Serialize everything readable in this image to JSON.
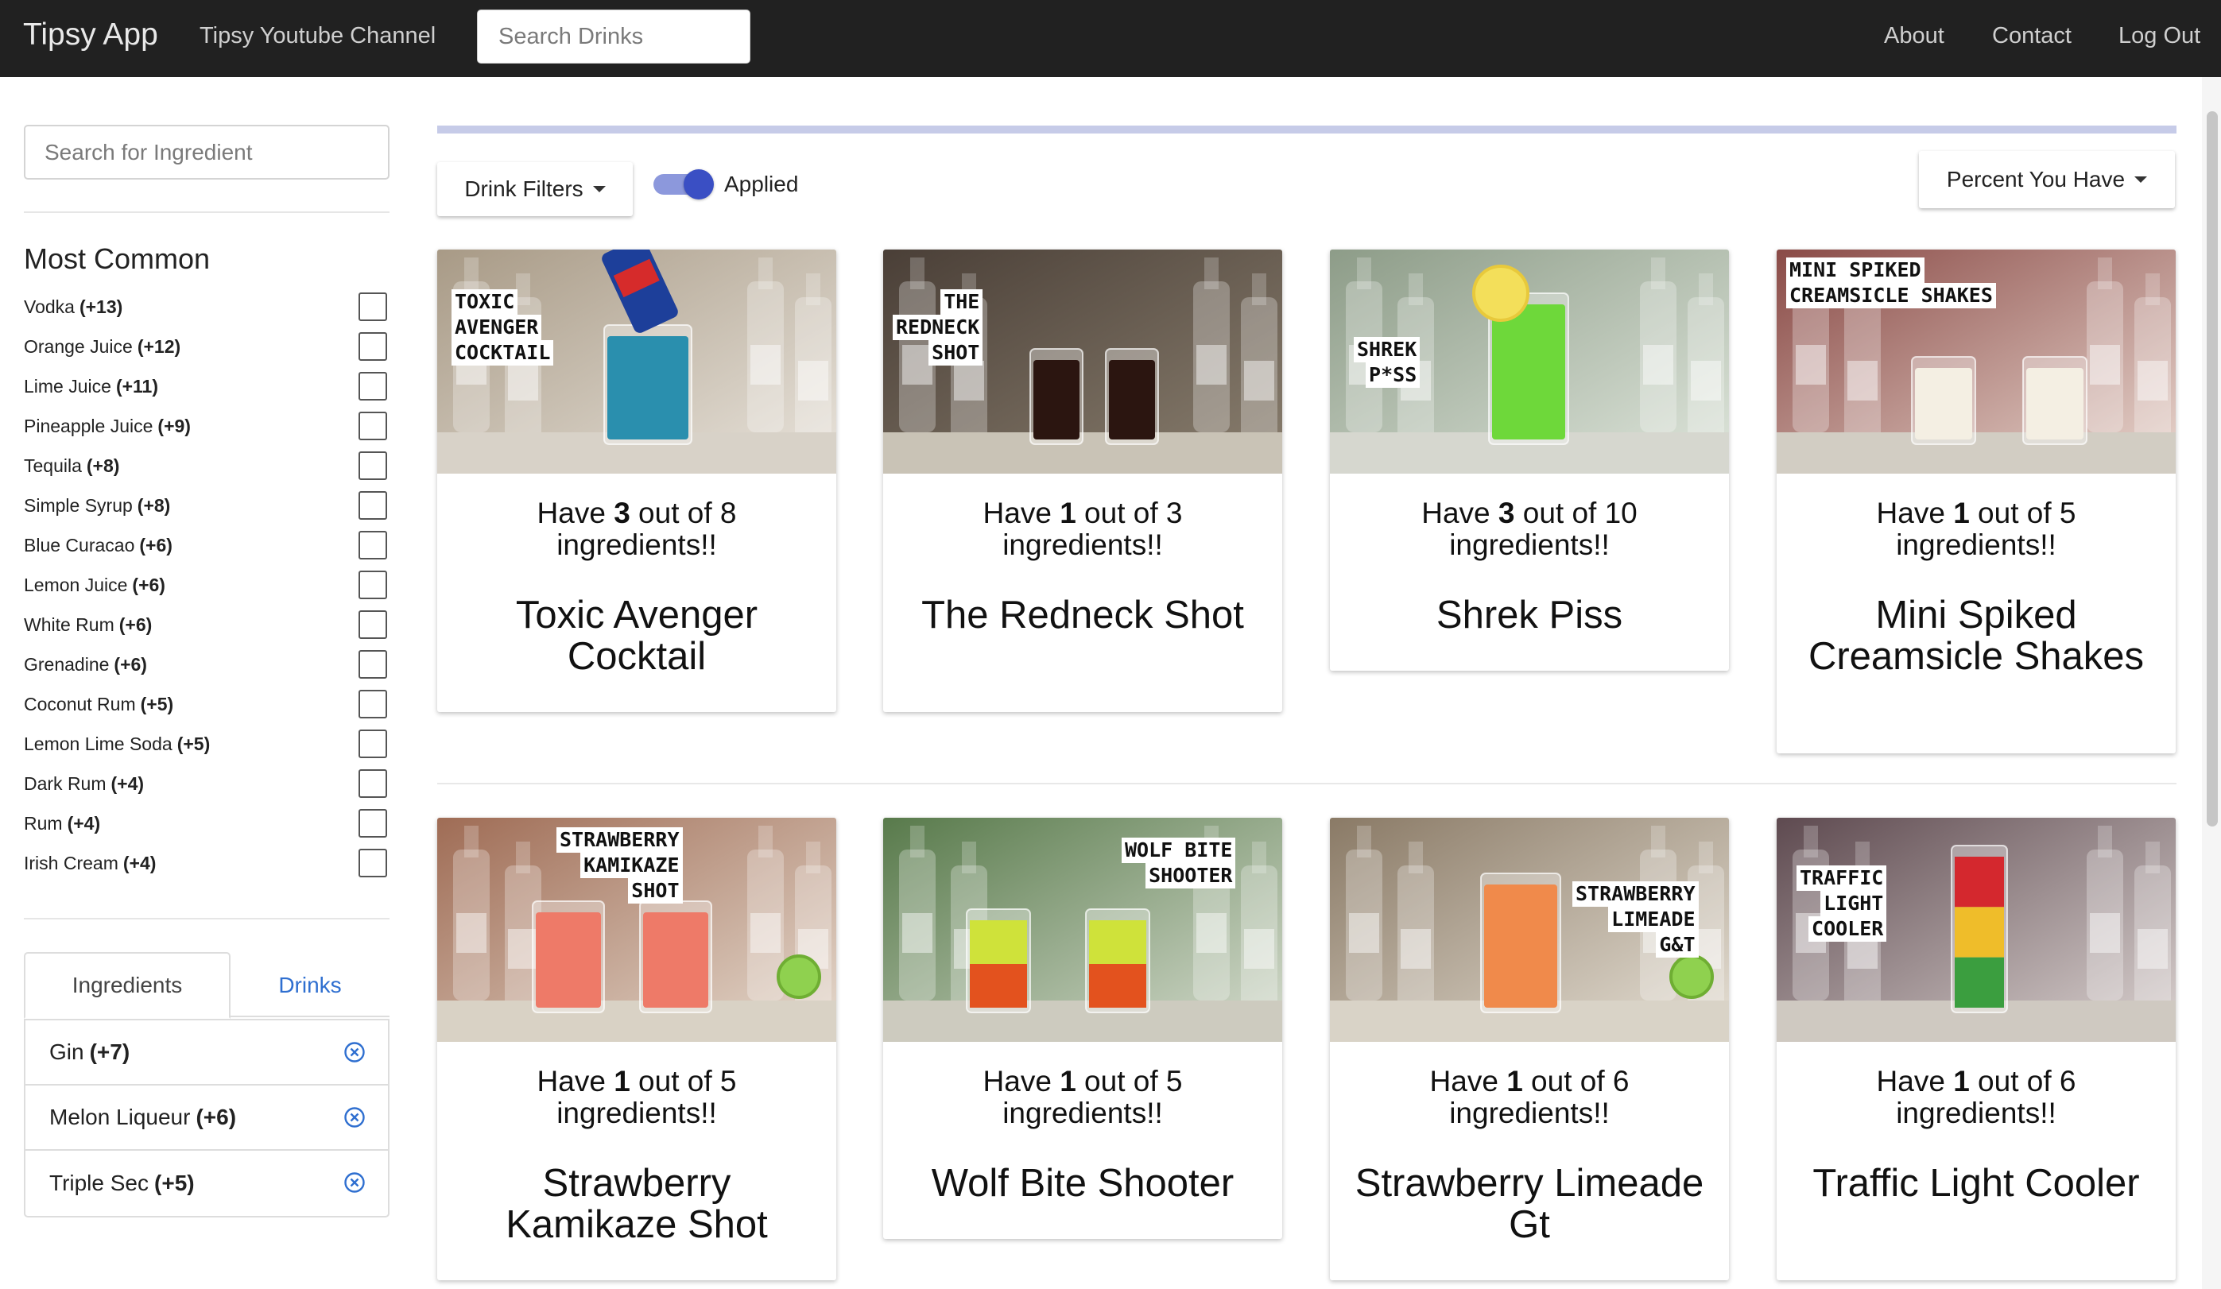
{
  "navbar": {
    "brand": "Tipsy App",
    "youtube_link": "Tipsy Youtube Channel",
    "search_placeholder": "Search Drinks",
    "about": "About",
    "contact": "Contact",
    "logout": "Log Out"
  },
  "sidebar": {
    "search_placeholder": "Search for Ingredient",
    "heading": "Most Common",
    "common": [
      {
        "name": "Vodka",
        "count": "(+13)"
      },
      {
        "name": "Orange Juice",
        "count": "(+12)"
      },
      {
        "name": "Lime Juice",
        "count": "(+11)"
      },
      {
        "name": "Pineapple Juice",
        "count": "(+9)"
      },
      {
        "name": "Tequila",
        "count": "(+8)"
      },
      {
        "name": "Simple Syrup",
        "count": "(+8)"
      },
      {
        "name": "Blue Curacao",
        "count": "(+6)"
      },
      {
        "name": "Lemon Juice",
        "count": "(+6)"
      },
      {
        "name": "White Rum",
        "count": "(+6)"
      },
      {
        "name": "Grenadine",
        "count": "(+6)"
      },
      {
        "name": "Coconut Rum",
        "count": "(+5)"
      },
      {
        "name": "Lemon Lime Soda",
        "count": "(+5)"
      },
      {
        "name": "Dark Rum",
        "count": "(+4)"
      },
      {
        "name": "Rum",
        "count": "(+4)"
      },
      {
        "name": "Irish Cream",
        "count": "(+4)"
      }
    ],
    "tabs": {
      "ingredients": "Ingredients",
      "drinks": "Drinks"
    },
    "selected": [
      {
        "name": "Gin",
        "count": "(+7)"
      },
      {
        "name": "Melon Liqueur",
        "count": "(+6)"
      },
      {
        "name": "Triple Sec",
        "count": "(+5)"
      }
    ]
  },
  "main": {
    "filters_label": "Drink Filters",
    "toggle_label": "Applied",
    "sort_label": "Percent You Have",
    "have_prefix": "Have",
    "have_middle": "out of",
    "have_suffix": "ingredients!!",
    "cards": [
      {
        "have": "3",
        "total": "8",
        "title": "Toxic Avenger Cocktail",
        "thumb": [
          "TOXIC",
          "AVENGER",
          "COCKTAIL"
        ]
      },
      {
        "have": "1",
        "total": "3",
        "title": "The Redneck Shot",
        "thumb": [
          "THE",
          "REDNECK",
          "SHOT"
        ]
      },
      {
        "have": "3",
        "total": "10",
        "title": "Shrek Piss",
        "thumb": [
          "SHREK",
          "P*SS"
        ]
      },
      {
        "have": "1",
        "total": "5",
        "title": "Mini Spiked Creamsicle Shakes",
        "thumb": [
          "MINI SPIKED",
          "CREAMSICLE SHAKES"
        ]
      },
      {
        "have": "1",
        "total": "5",
        "title": "Strawberry Kamikaze Shot",
        "thumb": [
          "STRAWBERRY",
          "KAMIKAZE",
          "SHOT"
        ]
      },
      {
        "have": "1",
        "total": "5",
        "title": "Wolf Bite Shooter",
        "thumb": [
          "WOLF BITE",
          "SHOOTER"
        ]
      },
      {
        "have": "1",
        "total": "6",
        "title": "Strawberry Limeade Gt",
        "thumb": [
          "STRAWBERRY",
          "LIMEADE",
          "G&T"
        ]
      },
      {
        "have": "1",
        "total": "6",
        "title": "Traffic Light Cooler",
        "thumb": [
          "TRAFFIC",
          "LIGHT",
          "COOLER"
        ]
      }
    ]
  }
}
